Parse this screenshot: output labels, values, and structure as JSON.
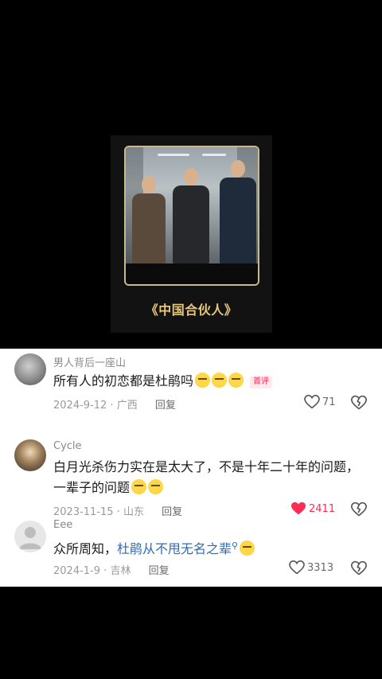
{
  "poster": {
    "title": "《中国合伙人》"
  },
  "comments": [
    {
      "username": "男人背后一座山",
      "text": "所有人的初恋都是杜鹃吗",
      "emoji_count": 3,
      "badge": "首评",
      "date": "2024-9-12",
      "location": "广西",
      "reply_label": "回复",
      "likes": "71",
      "liked": false
    },
    {
      "username": "Cycle",
      "text_line1": "白月光杀伤力实在是太大了，不是十年二十年的问题，",
      "text_line2": "一辈子的问题",
      "emoji_count": 2,
      "date": "2023-11-15",
      "location": "山东",
      "reply_label": "回复",
      "likes": "2411",
      "liked": true
    },
    {
      "username": "Eee",
      "text_prefix": "众所周知，",
      "link_text": "杜鹃从不甩无名之辈",
      "emoji_count": 1,
      "date": "2024-1-9",
      "location": "吉林",
      "reply_label": "回复",
      "likes": "3313",
      "liked": false
    }
  ],
  "icons": {
    "like": "heart-outline-icon",
    "liked": "heart-filled-icon",
    "dislike": "broken-heart-icon",
    "search": "search-icon"
  },
  "colors": {
    "accent": "#fe2c55",
    "link": "#2b6bb7",
    "poster_gold": "#e9c878"
  }
}
